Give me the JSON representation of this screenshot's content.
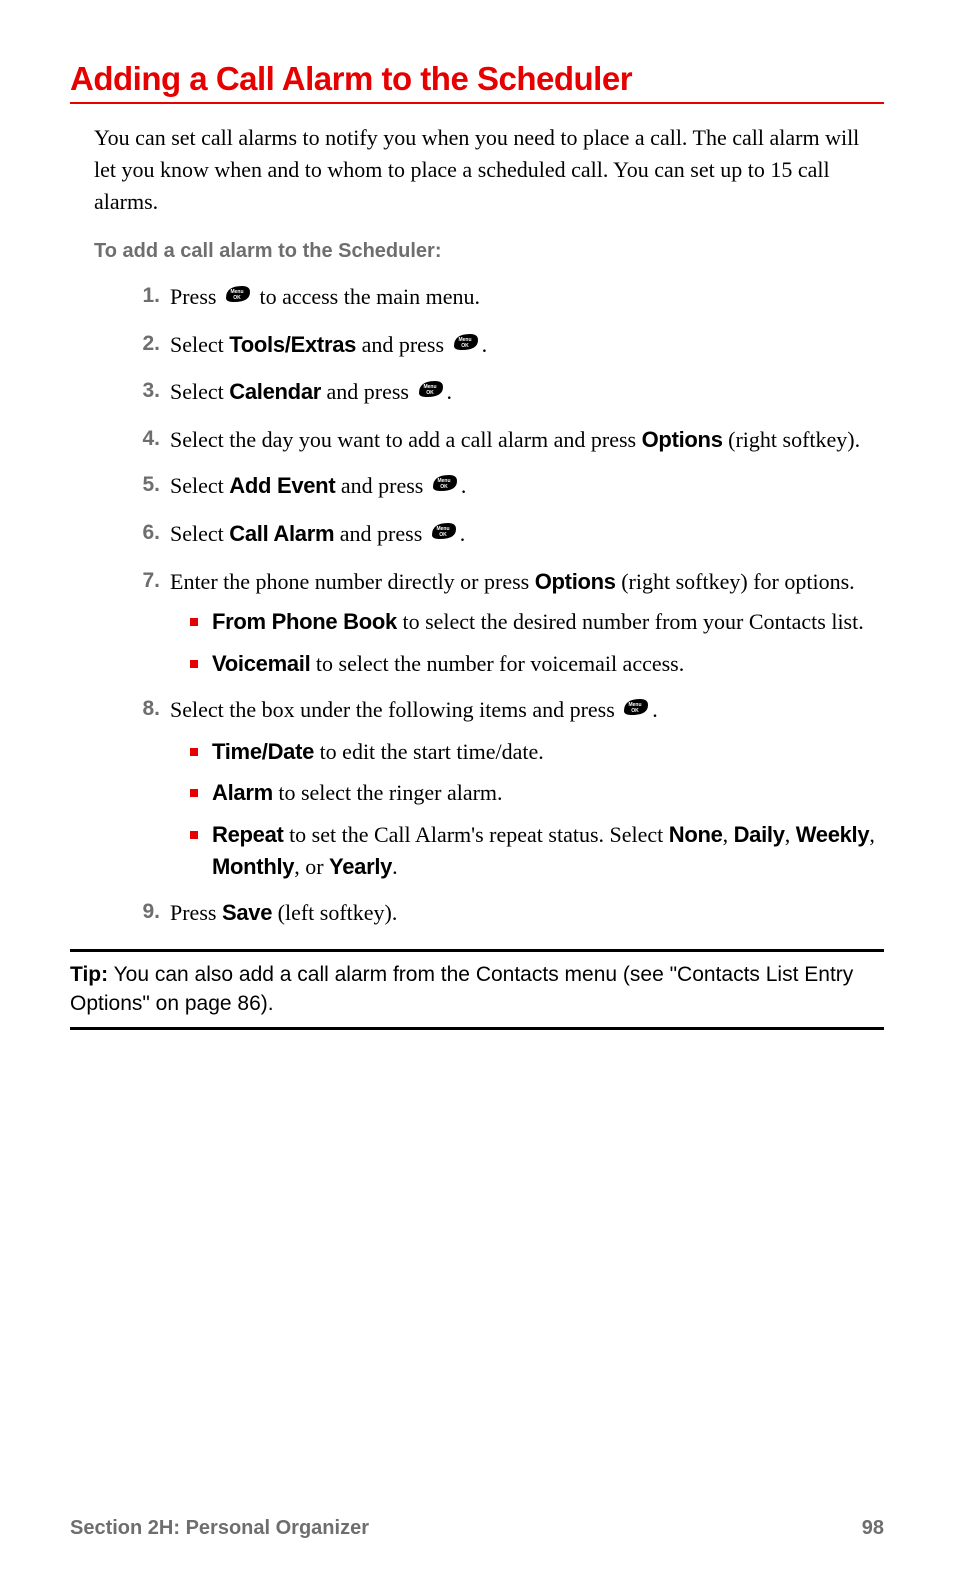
{
  "title": "Adding a Call Alarm to the Scheduler",
  "intro": "You can set call alarms to notify you when you need to place a call. The call alarm will let you know when and to whom to place a scheduled call. You can set up to 15 call alarms.",
  "subhead": "To add a call alarm to the Scheduler:",
  "icon_label": "Menu OK",
  "steps": [
    {
      "before": "Press ",
      "icon": true,
      "after": " to access the main menu."
    },
    {
      "before": "Select ",
      "bold": "Tools/Extras",
      "mid": " and press ",
      "icon": true,
      "after": "."
    },
    {
      "before": "Select ",
      "bold": "Calendar",
      "mid": " and press ",
      "icon": true,
      "after": "."
    },
    {
      "before": "Select the day you want to add a call alarm and press ",
      "bold": "Options",
      "after": " (right softkey)."
    },
    {
      "before": "Select ",
      "bold": "Add Event",
      "mid": " and press ",
      "icon": true,
      "after": "."
    },
    {
      "before": "Select ",
      "bold": "Call Alarm",
      "mid": " and press ",
      "icon": true,
      "after": "."
    },
    {
      "before": "Enter the phone number directly or press ",
      "bold": "Options",
      "after": " (right softkey) for options.",
      "sub": [
        {
          "bold": "From Phone Book",
          "text": " to select the desired number from your Contacts list."
        },
        {
          "bold": "Voicemail",
          "text": " to select the number for voicemail access."
        }
      ]
    },
    {
      "before": "Select the box under the following items and press ",
      "icon": true,
      "after": ".",
      "sub": [
        {
          "bold": "Time/Date",
          "text": " to edit the start time/date."
        },
        {
          "bold": "Alarm",
          "text": " to select the ringer alarm."
        },
        {
          "bold": "Repeat",
          "text_html": " to set the Call Alarm's repeat status. Select <b>None</b>, <b>Daily</b>, <b>Weekly</b>, <b>Monthly</b>, or <b>Yearly</b>."
        }
      ]
    },
    {
      "before": "Press ",
      "bold": "Save",
      "after": " (left softkey)."
    }
  ],
  "tip": {
    "label": "Tip:",
    "text": " You can also add a call alarm from the Contacts menu (see \"Contacts List Entry Options\" on page 86)."
  },
  "footer": {
    "section": "Section 2H: Personal Organizer",
    "page": "98"
  }
}
